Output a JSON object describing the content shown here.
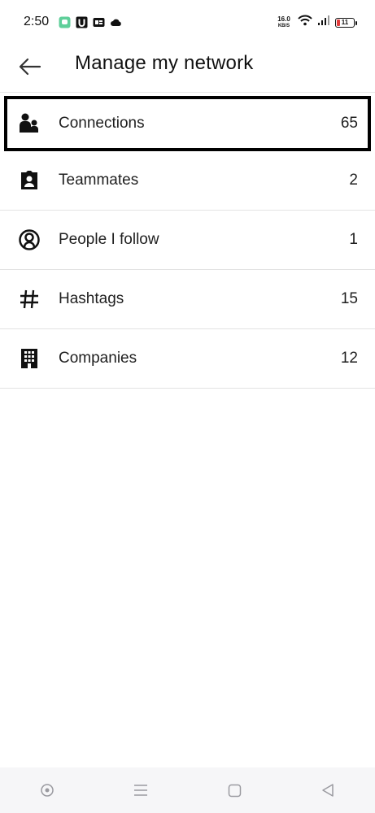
{
  "status_bar": {
    "time": "2:50",
    "net_speed_value": "16.0",
    "net_speed_unit": "KB/S",
    "battery_level": "11",
    "left_icons": [
      "chat-app-icon",
      "u-app-icon",
      "gb-app-icon",
      "cloud-icon"
    ],
    "right_icons": [
      "wifi-icon",
      "signal-icon",
      "battery-icon"
    ]
  },
  "header": {
    "back_icon": "arrow-left-icon",
    "title": "Manage my network"
  },
  "items": [
    {
      "icon": "people-icon",
      "label": "Connections",
      "count": "65"
    },
    {
      "icon": "badge-icon",
      "label": "Teammates",
      "count": "2"
    },
    {
      "icon": "person-circle-icon",
      "label": "People I follow",
      "count": "1"
    },
    {
      "icon": "hashtag-icon",
      "label": "Hashtags",
      "count": "15"
    },
    {
      "icon": "building-icon",
      "label": "Companies",
      "count": "12"
    }
  ],
  "colors": {
    "battery_low": "#e23b3b",
    "divider": "#e3e3e3",
    "nav_bg": "#f6f6f8"
  },
  "nav_bar": {
    "icons": [
      "assistant-icon",
      "menu-icon",
      "home-square-icon",
      "back-triangle-icon"
    ]
  }
}
